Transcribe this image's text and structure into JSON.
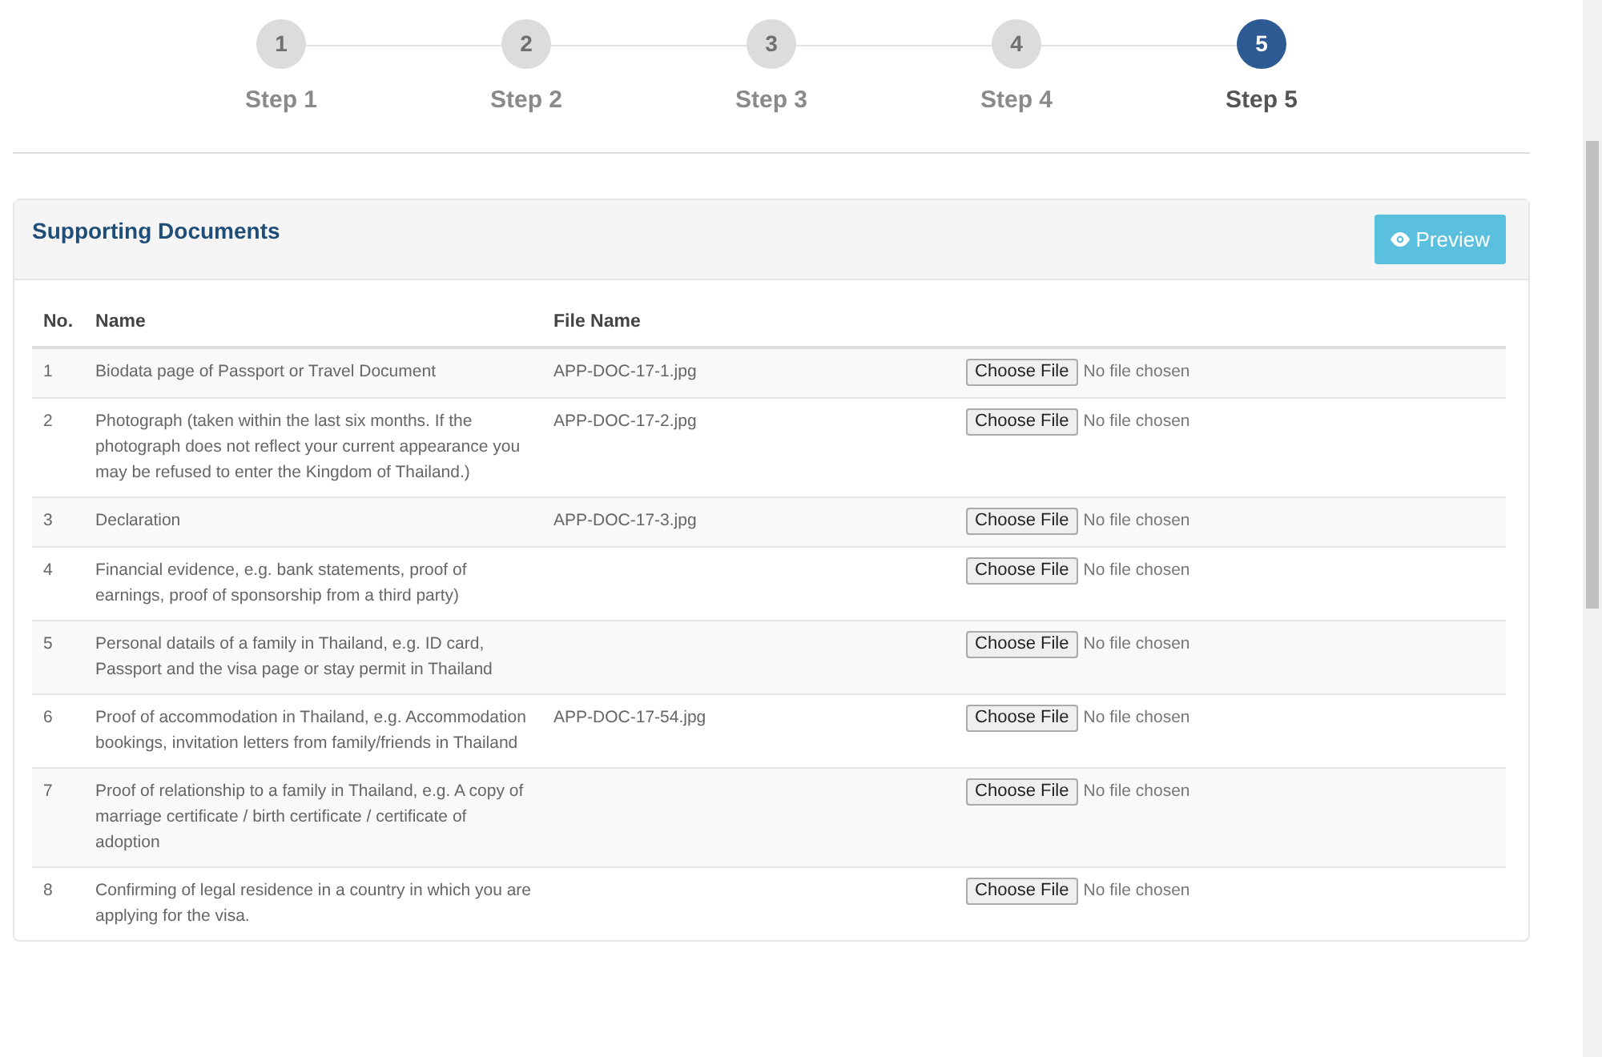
{
  "steps": [
    {
      "number": "1",
      "label": "Step 1",
      "selected": false
    },
    {
      "number": "2",
      "label": "Step 2",
      "selected": false
    },
    {
      "number": "3",
      "label": "Step 3",
      "selected": false
    },
    {
      "number": "4",
      "label": "Step 4",
      "selected": false
    },
    {
      "number": "5",
      "label": "Step 5",
      "selected": true
    }
  ],
  "panel": {
    "title": "Supporting Documents",
    "preview_button": "Preview"
  },
  "table": {
    "columns": [
      "No.",
      "Name",
      "File Name"
    ],
    "rows": [
      {
        "no": "1",
        "name": "Biodata page of Passport or Travel Document",
        "file_name": "APP-DOC-17-1.jpg",
        "button": "Choose File",
        "file_status": "No file chosen"
      },
      {
        "no": "2",
        "name": "Photograph (taken within the last six months. If the photograph does not reflect your current appearance you may be refused to enter the Kingdom of Thailand.)",
        "file_name": "APP-DOC-17-2.jpg",
        "button": "Choose File",
        "file_status": "No file chosen"
      },
      {
        "no": "3",
        "name": "Declaration",
        "file_name": "APP-DOC-17-3.jpg",
        "button": "Choose File",
        "file_status": "No file chosen"
      },
      {
        "no": "4",
        "name": "Financial evidence, e.g. bank statements, proof of earnings, proof of sponsorship from a third party)",
        "button": "Choose File",
        "file_status": "No file chosen"
      },
      {
        "no": "5",
        "name": "Personal datails of a family in Thailand, e.g. ID card, Passport and the visa page or stay permit in Thailand",
        "button": "Choose File",
        "file_status": "No file chosen"
      },
      {
        "no": "6",
        "name": "Proof of accommodation in Thailand, e.g. Accommodation bookings, invitation letters from family/friends in Thailand",
        "file_name": "APP-DOC-17-54.jpg",
        "button": "Choose File",
        "file_status": "No file chosen"
      },
      {
        "no": "7",
        "name": "Proof of relationship to a family in Thailand, e.g. A copy of marriage certificate / birth certificate / certificate of adoption",
        "button": "Choose File",
        "file_status": "No file chosen"
      },
      {
        "no": "8",
        "name": "Confirming of legal residence in a country in which you are applying for the visa.",
        "button": "Choose File",
        "file_status": "No file chosen"
      }
    ]
  }
}
